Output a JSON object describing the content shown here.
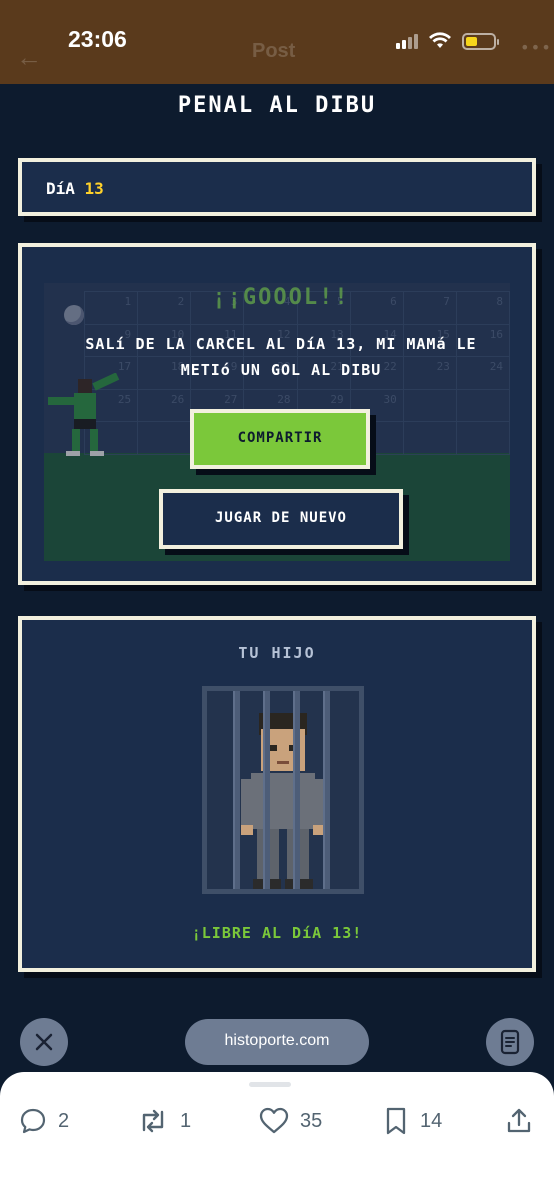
{
  "status_bar": {
    "time": "23:06",
    "underlying_title": "Post"
  },
  "game": {
    "title": "PENAL AL DIBU",
    "day_label": "DíA",
    "day_number": "13",
    "goal_banner": "¡¡GOOOL!!",
    "message": "SALí DE LA CARCEL AL DíA 13, MI MAMá LE METIó UN GOL AL DIBU",
    "share_button": "COMPARTIR",
    "replay_button": "JUGAR DE NUEVO",
    "grid_numbers": [
      "1",
      "2",
      "3",
      "4",
      "5",
      "6",
      "7",
      "8",
      "9",
      "10",
      "11",
      "12",
      "13",
      "14",
      "15",
      "16",
      "17",
      "18",
      "19",
      "20",
      "21",
      "22",
      "23",
      "24",
      "25",
      "26",
      "27",
      "28",
      "29",
      "30"
    ],
    "son_title": "TU HIJO",
    "son_status": "¡LIBRE AL DíA 13!"
  },
  "browser": {
    "url": "histoporte.com"
  },
  "actions": {
    "replies": "2",
    "reposts": "1",
    "likes": "35",
    "bookmarks": "14"
  },
  "icons": [
    "close-icon",
    "reader-icon",
    "reply-icon",
    "repost-icon",
    "like-icon",
    "bookmark-icon",
    "share-icon"
  ],
  "colors": {
    "accent_green": "#7bc83a",
    "day_yellow": "#ffd12a",
    "panel_border": "#f2f0de",
    "panel_bg": "#1b2d4b"
  }
}
